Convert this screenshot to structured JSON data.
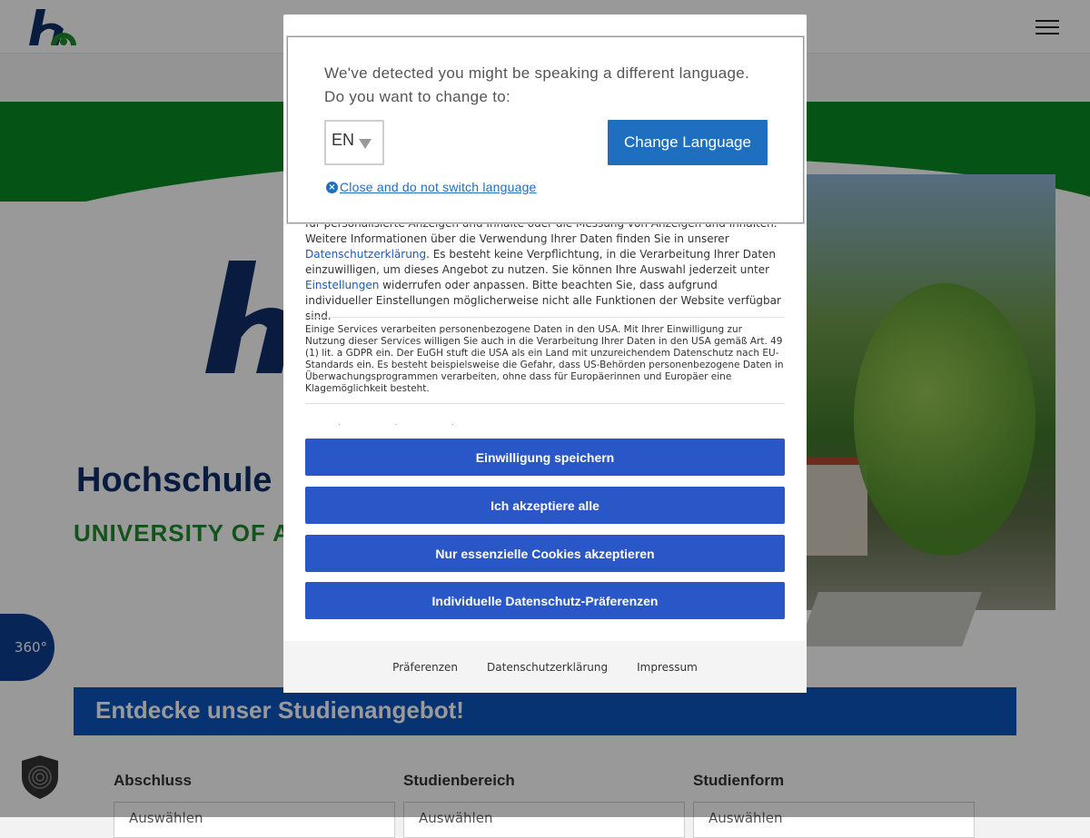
{
  "header": {
    "logo": "hs-logo",
    "menu_icon": "hamburger-icon"
  },
  "hero": {
    "title": "Hochschule",
    "subtitle": "UNIVERSITY OF A",
    "tour_label": "360°"
  },
  "studien": {
    "title": "Entdecke unser Studienangebot!",
    "filters": [
      {
        "label": "Abschluss",
        "value": "Auswählen"
      },
      {
        "label": "Studienbereich",
        "value": "Auswählen"
      },
      {
        "label": "Studienform",
        "value": "Auswählen"
      }
    ]
  },
  "cookie": {
    "para1_a": "für personalisierte Anzeigen und Inhalte oder die Messung von Anzeigen und Inhalten. Weitere Informationen über die Verwendung Ihrer Daten finden Sie in unserer ",
    "para1_link1": "Datenschutzerklärung",
    "para1_b": ". Es besteht keine Verpflichtung, in die Verarbeitung Ihrer Daten einzuwilligen, um dieses Angebot zu nutzen. Sie können Ihre Auswahl jederzeit unter ",
    "para1_link2": "Einstellungen",
    "para1_c": " widerrufen oder anpassen. Bitte beachten Sie, dass aufgrund individueller Einstellungen möglicherweise nicht alle Funktionen der Website verfügbar sind.",
    "para2": "Einige Services verarbeiten personenbezogene Daten in den USA. Mit Ihrer Einwilligung zur Nutzung dieser Services willigen Sie auch in die Verarbeitung Ihrer Daten in den USA gemäß Art. 49 (1) lit. a GDPR ein. Der EuGH stuft die USA als ein Land mit unzureichendem Datenschutz nach EU-Standards ein. Es besteht beispielsweise die Gefahr, dass US-Behörden personenbezogene Daten in Überwachungsprogrammen verarbeiten, ohne dass für Europäerinnen und Europäer eine Klagemöglichkeit besteht.",
    "buttons": {
      "save": "Einwilligung speichern",
      "accept_all": "Ich akzeptiere alle",
      "essential": "Nur essenzielle Cookies akzeptieren",
      "individual": "Individuelle Datenschutz-Präferenzen"
    },
    "footer": {
      "prefs": "Präferenzen",
      "privacy": "Datenschutzerklärung",
      "imprint": "Impressum"
    }
  },
  "lang_dialog": {
    "message_line1": "We've detected you might be speaking a different language.",
    "message_line2": "Do you want to change to:",
    "selected_language": "EN",
    "change_button": "Change Language",
    "close_link": "Close and do not switch language"
  },
  "colors": {
    "brand_blue": "#0f2f6a",
    "brand_green": "#1e8a2c",
    "button_blue": "#2a57c8",
    "lang_blue": "#1f6fc0"
  }
}
